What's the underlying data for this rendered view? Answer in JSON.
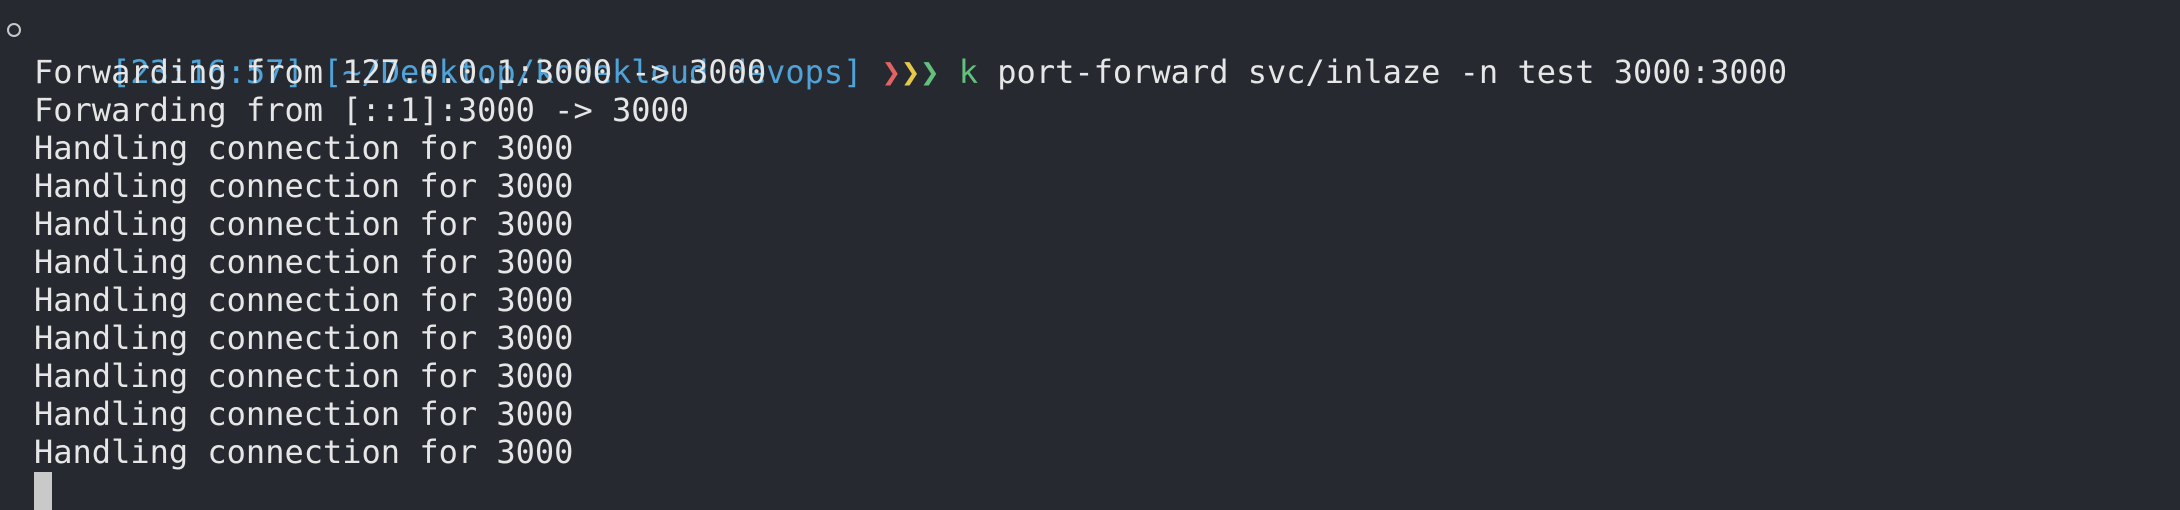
{
  "terminal": {
    "prompt": {
      "time": "[23:16:57]",
      "path": "[~/Desktop/kodekloud devops]",
      "chevrons": [
        "❯",
        "❯",
        "❯"
      ],
      "command_alias": "k",
      "command_args": "port-forward svc/inlaze -n test 3000:3000"
    },
    "output": [
      "Forwarding from 127.0.0.1:3000 -> 3000",
      "Forwarding from [::1]:3000 -> 3000",
      "Handling connection for 3000",
      "Handling connection for 3000",
      "Handling connection for 3000",
      "Handling connection for 3000",
      "Handling connection for 3000",
      "Handling connection for 3000",
      "Handling connection for 3000",
      "Handling connection for 3000",
      "Handling connection for 3000"
    ]
  },
  "colors": {
    "background": "#262a30",
    "text": "#e6e6e6",
    "prompt_blue": "#4fa3d9",
    "chevron_red": "#e26363",
    "chevron_yellow": "#e6c84b",
    "chevron_green": "#62c27d"
  }
}
